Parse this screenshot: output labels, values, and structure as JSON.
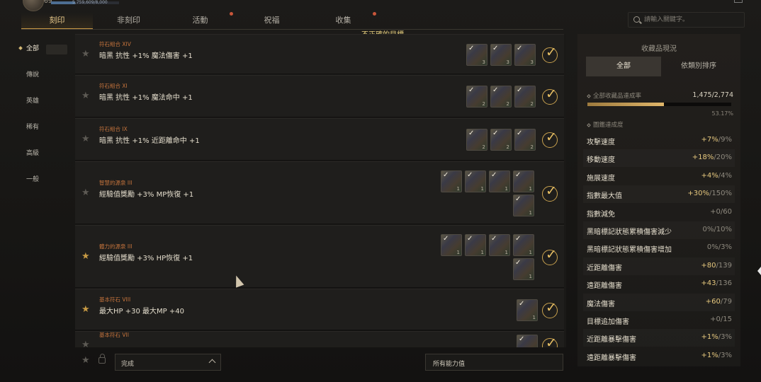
{
  "header": {
    "level": "69",
    "exp_text": "5,759,609/8,000",
    "exp_fraction": 0.35,
    "tabs": [
      {
        "label": "刻印",
        "active": true,
        "dot": false
      },
      {
        "label": "非刻印",
        "active": false,
        "dot": false
      },
      {
        "label": "活動",
        "active": false,
        "dot": true
      },
      {
        "label": "祝福",
        "active": false,
        "dot": false
      },
      {
        "label": "收集",
        "active": false,
        "dot": true
      }
    ],
    "warning": "不正確的目標。",
    "search_placeholder": "請輸入關鍵字。"
  },
  "nav": {
    "items": [
      {
        "label": "全部",
        "active": true
      },
      {
        "label": "傳說",
        "active": false
      },
      {
        "label": "英雄",
        "active": false
      },
      {
        "label": "稀有",
        "active": false
      },
      {
        "label": "高級",
        "active": false
      },
      {
        "label": "一般",
        "active": false
      }
    ]
  },
  "list": [
    {
      "category": "符石組合 XIV",
      "effect": "暗黑 抗性 +1% 魔法傷害 +1",
      "favorite": false,
      "cards": [
        {
          "count": "3"
        },
        {
          "count": "3"
        },
        {
          "count": "3"
        }
      ]
    },
    {
      "category": "符石組合 XI",
      "effect": "暗黑 抗性 +1% 魔法命中 +1",
      "favorite": false,
      "cards": [
        {
          "count": "2"
        },
        {
          "count": "2"
        },
        {
          "count": "2"
        }
      ]
    },
    {
      "category": "符石組合 IX",
      "effect": "暗黑 抗性 +1% 近距離命中 +1",
      "favorite": false,
      "cards": [
        {
          "count": "2"
        },
        {
          "count": "2"
        },
        {
          "count": "2"
        }
      ]
    },
    {
      "category": "智慧的源泉 III",
      "effect": "經驗值獎勵 +3% MP恢復 +1",
      "favorite": false,
      "cards": [
        {
          "count": "1"
        },
        {
          "count": "1"
        },
        {
          "count": "1"
        },
        {
          "count": "1"
        },
        {
          "count": "1"
        }
      ]
    },
    {
      "category": "體力的源泉 III",
      "effect": "經驗值獎勵 +3% HP恢復 +1",
      "favorite": true,
      "cards": [
        {
          "count": "1"
        },
        {
          "count": "1"
        },
        {
          "count": "1"
        },
        {
          "count": "1"
        },
        {
          "count": "1"
        }
      ]
    },
    {
      "category": "基本符石 VIII",
      "effect": "最大HP +30 最大MP +40",
      "favorite": true,
      "cards": [
        {
          "count": "1"
        }
      ]
    },
    {
      "category": "基本符石 VII",
      "effect": "",
      "favorite": false,
      "cards": [
        {
          "count": "1"
        }
      ]
    }
  ],
  "bottom": {
    "filter_label": "完成",
    "all_stats_label": "所有能力值"
  },
  "panel": {
    "title": "收藏品現況",
    "seg_all": "全部",
    "seg_sort": "依類別排序",
    "collect_rate_label": "全部收藏品達成率",
    "collect_rate_value": "1,475/2,774",
    "collect_rate_percent": "53.17%",
    "collect_fraction": 0.5317,
    "achievement_label": "圖鑑達成度",
    "stats": [
      {
        "name": "攻擊速度",
        "current": "+7%",
        "max": "9%"
      },
      {
        "name": "移動速度",
        "current": "+18%",
        "max": "20%"
      },
      {
        "name": "施展速度",
        "current": "+4%",
        "max": "4%"
      },
      {
        "name": "指數最大值",
        "current": "+30%",
        "max": "150%"
      },
      {
        "name": "指數減免",
        "current": "+0",
        "max": "60"
      },
      {
        "name": "黑暗標記狀態累積傷害減少",
        "current": "0%",
        "max": "10%"
      },
      {
        "name": "黑暗標記狀態累積傷害增加",
        "current": "0%",
        "max": "3%"
      },
      {
        "name": "近距離傷害",
        "current": "+80",
        "max": "139"
      },
      {
        "name": "遠距離傷害",
        "current": "+43",
        "max": "136"
      },
      {
        "name": "魔法傷害",
        "current": "+60",
        "max": "79"
      },
      {
        "name": "目標追加傷害",
        "current": "+0",
        "max": "15"
      },
      {
        "name": "近距離暴擊傷害",
        "current": "+1%",
        "max": "3%"
      },
      {
        "name": "遠距離暴擊傷害",
        "current": "+1%",
        "max": "3%"
      }
    ]
  }
}
